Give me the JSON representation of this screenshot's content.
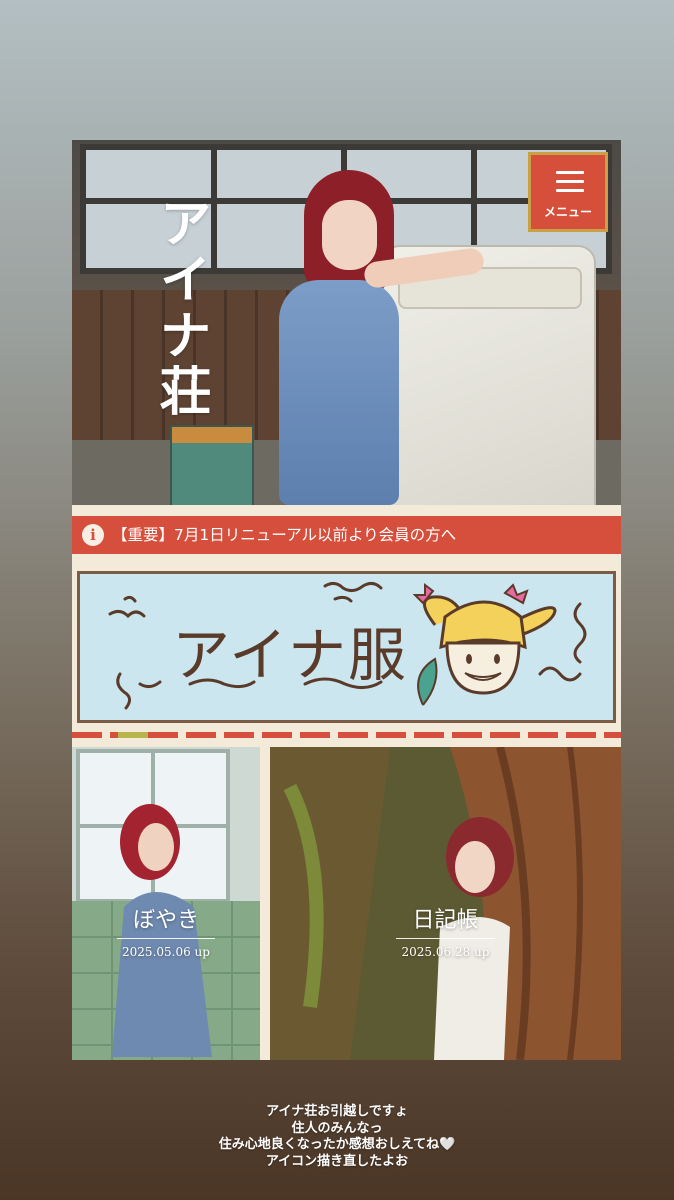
{
  "site": {
    "title": "アイナ荘",
    "menu_label": "メニュー",
    "notice": "【重要】7月1日リニューアル以前より会員の方へ",
    "banner_logo": "アイナ服",
    "cards": [
      {
        "title": "ぼやき",
        "date": "2025.05.06 up"
      },
      {
        "title": "日記帳",
        "date": "2025.06.28 up"
      }
    ]
  },
  "story_caption": [
    "アイナ荘お引越しですょ",
    "住人のみんなっ",
    "住み心地良くなったか感想おしえてね🤍",
    "アイコン描き直したよお"
  ],
  "colors": {
    "accent_red": "#d54f3c",
    "menu_border_gold": "#c9a043",
    "banner_bg": "#cbe6ef",
    "site_bg": "#f3ead9"
  }
}
